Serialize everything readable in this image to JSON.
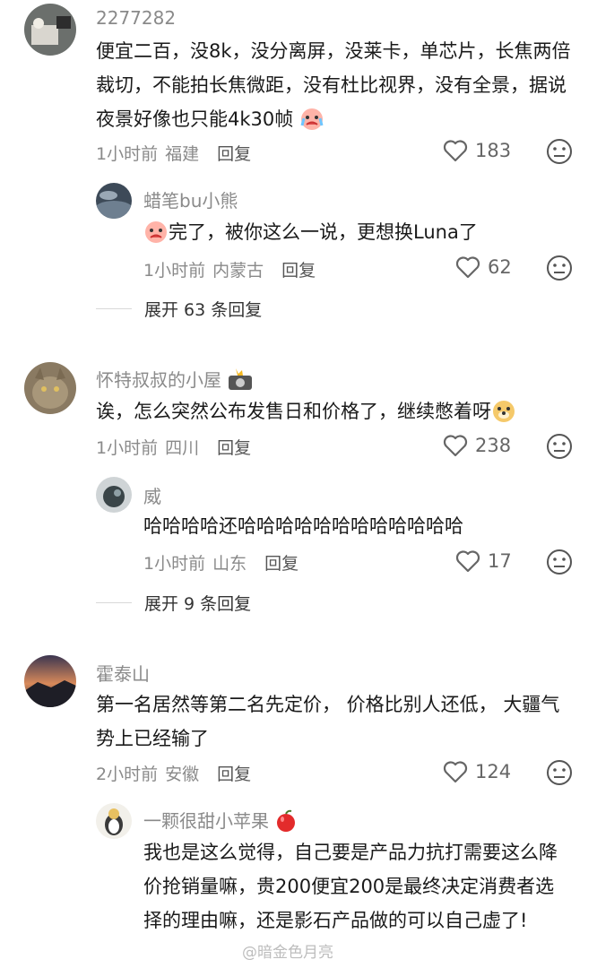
{
  "comments": [
    {
      "user": "2277282",
      "text": "便宜二百，没8k，没分离屏，没莱卡，单芯片，长焦两倍裁切，不能拍长焦微距，没有杜比视界，没有全景，据说夜景好像也只能4k30帧",
      "time": "1小时前",
      "location": "福建",
      "reply_label": "回复",
      "likes": "183",
      "replies": [
        {
          "user": "蜡笔bu小熊",
          "text": "完了，被你这么一说，更想换Luna了",
          "time": "1小时前",
          "location": "内蒙古",
          "reply_label": "回复",
          "likes": "62"
        }
      ],
      "expand_label": "展开 63 条回复"
    },
    {
      "user": "怀特叔叔的小屋",
      "text": "诶，怎么突然公布发售日和价格了，继续憋着呀",
      "time": "1小时前",
      "location": "四川",
      "reply_label": "回复",
      "likes": "238",
      "replies": [
        {
          "user": "威",
          "text": "哈哈哈哈还哈哈哈哈哈哈哈哈哈哈哈哈",
          "time": "1小时前",
          "location": "山东",
          "reply_label": "回复",
          "likes": "17"
        }
      ],
      "expand_label": "展开 9 条回复"
    },
    {
      "user": "霍泰山",
      "text": "第一名居然等第二名先定价， 价格比别人还低， 大疆气势上已经输了",
      "time": "2小时前",
      "location": "安徽",
      "reply_label": "回复",
      "likes": "124",
      "replies": [
        {
          "user": "一颗很甜小苹果",
          "text": "我也是这么觉得，自己要是产品力抗打需要这么降价抢销量嘛，贵200便宜200是最终决定消费者选择的理由嘛，还是影石产品做的可以自己虚了!"
        }
      ]
    }
  ],
  "watermark": "@暗金色月亮",
  "icons": {
    "like": "heart-outline-icon",
    "dislike": "neutral-face-icon"
  }
}
